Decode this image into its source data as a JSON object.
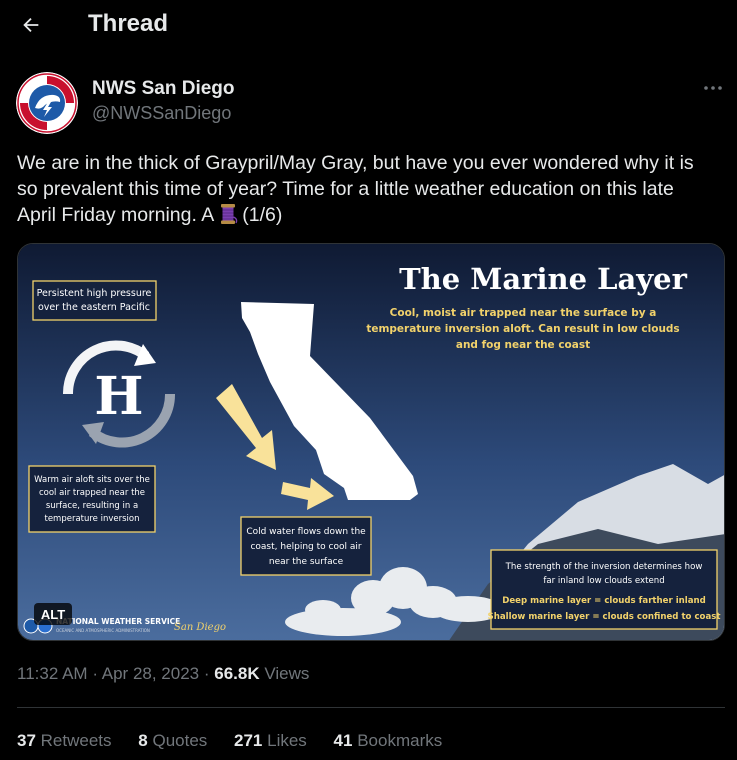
{
  "header": {
    "title": "Thread"
  },
  "tweet": {
    "author": {
      "name": "NWS San Diego",
      "handle": "@NWSSanDiego"
    },
    "text_before_emoji": "We are in the thick of Graypril/May Gray, but have you ever wondered why it is so prevalent this time of year? Time for a little weather education on this late April Friday morning. A",
    "text_after_emoji": "(1/6)",
    "media": {
      "alt_label": "ALT",
      "title": "The Marine Layer",
      "subtitle_lines": [
        "Cool, moist air trapped near the surface by a",
        "temperature inversion aloft. Can result in low clouds",
        "and fog near the coast"
      ],
      "high_pressure_lines": [
        "Persistent high pressure",
        "over the eastern Pacific"
      ],
      "high_symbol": "H",
      "warm_air_lines": [
        "Warm air aloft sits over the",
        "cool air trapped near the",
        "surface, resulting in a",
        "temperature inversion"
      ],
      "cold_water_lines": [
        "Cold water flows down the",
        "coast, helping to cool air",
        "near the surface"
      ],
      "inversion_lines": [
        "The strength of the inversion determines how",
        "far inland low clouds extend"
      ],
      "deep_layer": "Deep marine layer = clouds farther inland",
      "shallow_layer": "Shallow marine layer = clouds confined to coast",
      "nws_name": "NATIONAL WEATHER SERVICE",
      "noaa_line": "OCEANIC AND ATMOSPHERIC ADMINISTRATION",
      "office": "San Diego"
    },
    "time": "11:32 AM",
    "date": "Apr 28, 2023",
    "views_count": "66.8K",
    "views_label": "Views",
    "stats": {
      "retweets": {
        "count": "37",
        "label": "Retweets"
      },
      "quotes": {
        "count": "8",
        "label": "Quotes"
      },
      "likes": {
        "count": "271",
        "label": "Likes"
      },
      "bookmarks": {
        "count": "41",
        "label": "Bookmarks"
      }
    }
  },
  "icons": {
    "back": "back-arrow-icon",
    "more": "more-dots-icon",
    "emoji": "thread-spool-emoji"
  },
  "colors": {
    "background": "#000000",
    "text": "#e7e9ea",
    "muted": "#71767b",
    "divider": "#2f3336",
    "infographic_yellow": "#f2d26b",
    "infographic_navy": "#1b2a4a"
  }
}
